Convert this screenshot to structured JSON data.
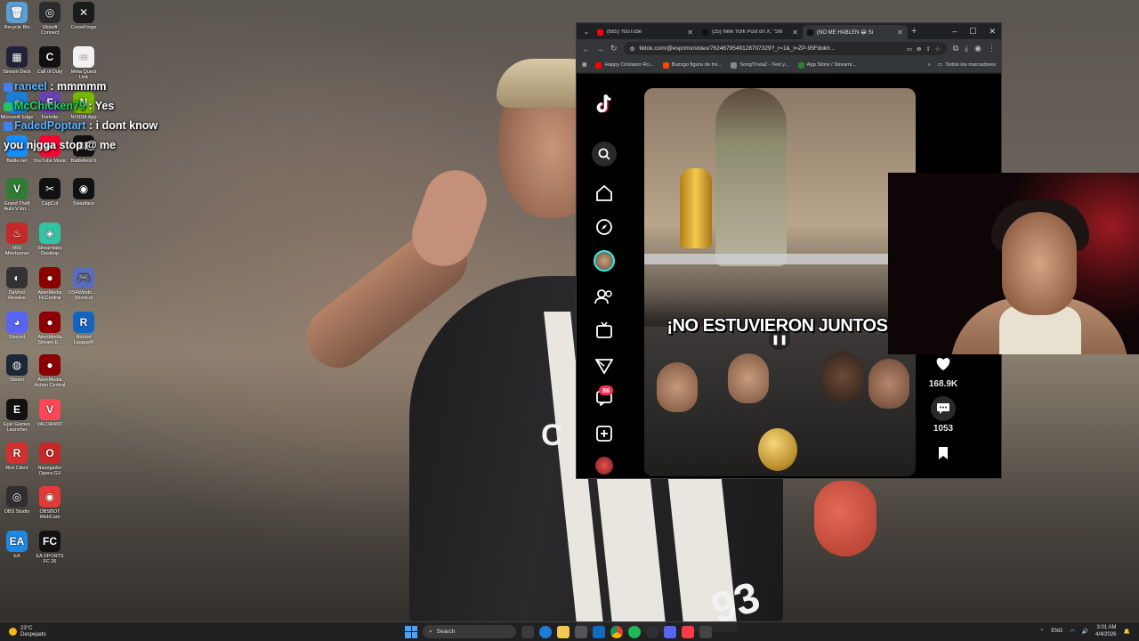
{
  "desktop": {
    "icons": [
      {
        "label": "Recycle Bin",
        "color": "#5aa0d8",
        "glyph": "🗑"
      },
      {
        "label": "Ubisoft Connect",
        "color": "#2c2c2c",
        "glyph": "◎"
      },
      {
        "label": "CurseForge",
        "color": "#1b1b1b",
        "glyph": "✕"
      },
      {
        "label": "Stream Deck",
        "color": "#22223a",
        "glyph": "▦"
      },
      {
        "label": "Call of Duty",
        "color": "#111",
        "glyph": "C"
      },
      {
        "label": "Meta Quest Link",
        "color": "#f2f2f2",
        "glyph": "∞"
      },
      {
        "label": "Microsoft Edge",
        "color": "#1c7dd7",
        "glyph": "e"
      },
      {
        "label": "Fortnite",
        "color": "#6c3fb5",
        "glyph": "F"
      },
      {
        "label": "NVIDIA App",
        "color": "#76b900",
        "glyph": "N"
      },
      {
        "label": "Battle.net",
        "color": "#148eff",
        "glyph": "✦"
      },
      {
        "label": "YouTube Music",
        "color": "#ff0033",
        "glyph": "▶"
      },
      {
        "label": "Battlefield 6",
        "color": "#111",
        "glyph": "BF"
      },
      {
        "label": "Grand Theft Auto V En...",
        "color": "#2e7d32",
        "glyph": "V"
      },
      {
        "label": "CapCut",
        "color": "#111",
        "glyph": "✂"
      },
      {
        "label": "Swapface",
        "color": "#111",
        "glyph": "◉"
      },
      {
        "label": "MSI Afterburner",
        "color": "#c62828",
        "glyph": "♨"
      },
      {
        "label": "Streamlabs Desktop",
        "color": "#31c3a2",
        "glyph": "◈"
      },
      {
        "label": "DaVinci Resolve",
        "color": "#333",
        "glyph": "◐"
      },
      {
        "label": "AlienMedia FECentral",
        "color": "#8b0000",
        "glyph": "●"
      },
      {
        "label": "DS4Windo... - Shortcut",
        "color": "#5c6bc0",
        "glyph": "🎮"
      },
      {
        "label": "Discord",
        "color": "#5865f2",
        "glyph": "◕"
      },
      {
        "label": "AlienMedia Stream E...",
        "color": "#8b0000",
        "glyph": "●"
      },
      {
        "label": "Rocket League®",
        "color": "#1565c0",
        "glyph": "R"
      },
      {
        "label": "Steam",
        "color": "#1b2838",
        "glyph": "◍"
      },
      {
        "label": "AlienMedia Action Central",
        "color": "#8b0000",
        "glyph": "●"
      },
      {
        "label": "Epic Games Launcher",
        "color": "#111",
        "glyph": "E"
      },
      {
        "label": "VALORANT",
        "color": "#ff4655",
        "glyph": "V"
      },
      {
        "label": "Riot Client",
        "color": "#d32f2f",
        "glyph": "R"
      },
      {
        "label": "Navegador Opera GX",
        "color": "#c62828",
        "glyph": "O"
      },
      {
        "label": "OBS Studio",
        "color": "#302e31",
        "glyph": "◎"
      },
      {
        "label": "OBSBOT WebCam",
        "color": "#e53935",
        "glyph": "◉"
      },
      {
        "label": "EA",
        "color": "#1e88e5",
        "glyph": "EA"
      },
      {
        "label": "EA SPORTS FC 26",
        "color": "#111",
        "glyph": "FC"
      }
    ]
  },
  "chat": [
    {
      "user": "raneel",
      "message": ": mmmmm",
      "style": "blue"
    },
    {
      "user": "McChicken79",
      "message": ": Yes",
      "style": "green"
    },
    {
      "user": "FadedPoptart",
      "message": ": i dont know",
      "style": "blue"
    },
    {
      "user": "",
      "message": "you njgga stop @ me",
      "style": "plain"
    }
  ],
  "browser": {
    "tabs": [
      {
        "label": "(685) YouTube",
        "color": "#ff0000",
        "active": false
      },
      {
        "label": "(25) New York Post on X: \"Shi",
        "color": "#111111",
        "active": false
      },
      {
        "label": "(NO ME HABLEN 😂 Si",
        "color": "#111111",
        "active": true
      }
    ],
    "url": "tiktok.com/@espnmx/video/7624679549128707329?_r=1&_t=ZP-95Fdokh...",
    "bookmarks": [
      {
        "label": "Happy Cristiano Ro...",
        "color": "#ff0000"
      },
      {
        "label": "Buzzgo figura de tre...",
        "color": "#ff4500"
      },
      {
        "label": "SongTrivia2 - Test y...",
        "color": "#888"
      },
      {
        "label": "App Store / Streami...",
        "color": "#2e7d32"
      }
    ],
    "bookmarks_all": "Todos los marcadores"
  },
  "tiktok": {
    "notification_count": "86",
    "video_caption": "¡NO ESTUVIERON JUNTOS!",
    "likes": "168.9K",
    "comments": "1053"
  },
  "taskbar": {
    "weather_temp": "23°C",
    "weather_desc": "Despejado",
    "search_placeholder": "Search",
    "language": "ENG",
    "time": "3:01 AM",
    "date": "4/4/2026"
  }
}
